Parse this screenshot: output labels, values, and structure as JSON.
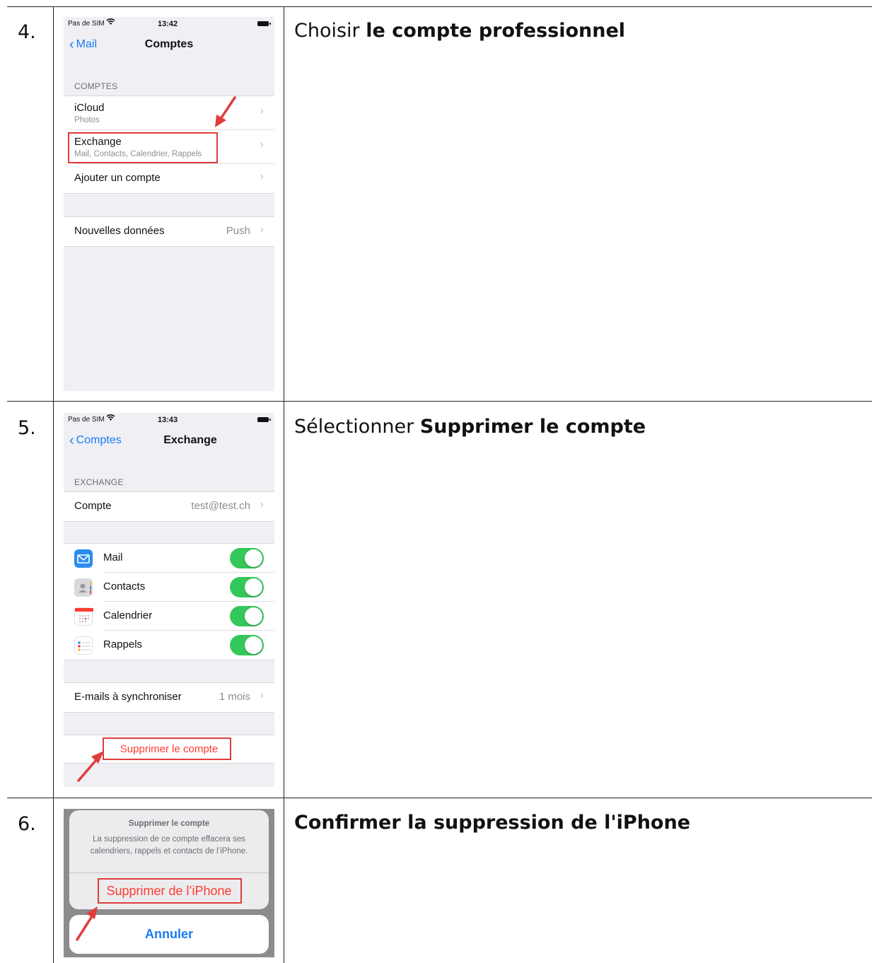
{
  "steps": [
    {
      "number": "4.",
      "instruction_prefix": "Choisir ",
      "instruction_bold": "le compte professionnel",
      "phone": {
        "carrier": "Pas de SIM",
        "time": "13:42",
        "back_label": "Mail",
        "title": "Comptes",
        "section_header": "COMPTES",
        "accounts": [
          {
            "label": "iCloud",
            "sub": "Photos"
          },
          {
            "label": "Exchange",
            "sub": "Mail, Contacts, Calendrier, Rappels"
          },
          {
            "label": "Ajouter un compte"
          }
        ],
        "fetch": {
          "label": "Nouvelles données",
          "detail": "Push"
        }
      }
    },
    {
      "number": "5.",
      "instruction_prefix": "Sélectionner ",
      "instruction_bold": "Supprimer le compte",
      "phone": {
        "carrier": "Pas de SIM",
        "time": "13:43",
        "back_label": "Comptes",
        "title": "Exchange",
        "section_header": "EXCHANGE",
        "account": {
          "label": "Compte",
          "detail": "test@test.ch"
        },
        "services": [
          {
            "label": "Mail",
            "icon": "mail-icon",
            "enabled": true
          },
          {
            "label": "Contacts",
            "icon": "contacts-icon",
            "enabled": true
          },
          {
            "label": "Calendrier",
            "icon": "calendar-icon",
            "enabled": true
          },
          {
            "label": "Rappels",
            "icon": "reminders-icon",
            "enabled": true
          }
        ],
        "sync": {
          "label": "E-mails à synchroniser",
          "detail": "1 mois"
        },
        "delete_label": "Supprimer le compte"
      }
    },
    {
      "number": "6.",
      "instruction_bold": "Confirmer la suppression de l'iPhone",
      "alert": {
        "title": "Supprimer le compte",
        "message": "La suppression de ce compte effacera ses calendriers, rappels et contacts de l’iPhone.",
        "action": "Supprimer de l’iPhone",
        "cancel": "Annuler"
      }
    }
  ],
  "colors": {
    "ios_blue": "#1a7cf5",
    "ios_red": "#ff3b30",
    "toggle_green": "#34c759",
    "highlight_red": "#e03c3c"
  }
}
